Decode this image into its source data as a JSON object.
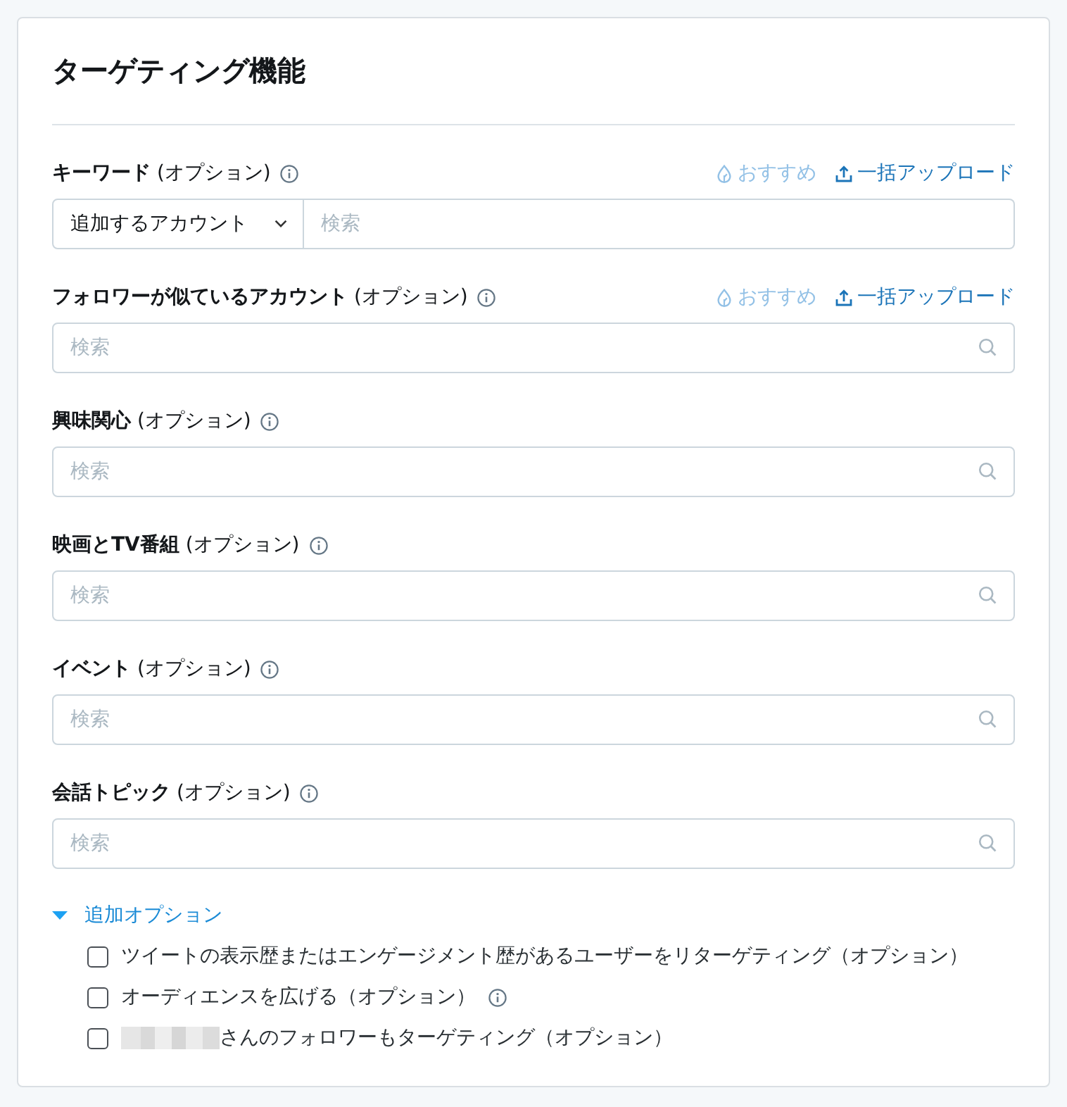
{
  "title": "ターゲティング機能",
  "fields": [
    {
      "kind": "dropdown_search",
      "label": "**キーワード** (オプション)",
      "dropdown": "追加するアカウント",
      "placeholder": "検索",
      "links": [
        {
          "kind": "recommend",
          "label": "おすすめ",
          "disabled": true
        },
        {
          "kind": "upload",
          "label": "一括アップロード",
          "disabled": false
        }
      ]
    },
    {
      "kind": "search",
      "label": "**フォロワーが似ているアカウント** (オプション)",
      "placeholder": "検索",
      "links": [
        {
          "kind": "recommend",
          "label": "おすすめ",
          "disabled": true
        },
        {
          "kind": "upload",
          "label": "一括アップロード",
          "disabled": false
        }
      ]
    },
    {
      "kind": "search",
      "label": "**興味関心** (オプション)",
      "placeholder": "検索"
    },
    {
      "kind": "search",
      "label": "**映画とTV番組** (オプション)",
      "placeholder": "検索"
    },
    {
      "kind": "search",
      "label": "**イベント** (オプション)",
      "placeholder": "検索"
    },
    {
      "kind": "search",
      "label": "**会話トピック** (オプション)",
      "placeholder": "検索"
    }
  ],
  "more_options": {
    "label": "追加オプション",
    "expanded": true,
    "options": [
      {
        "label": "ツイートの表示歴またはエンゲージメント歴があるユーザーをリターゲティング（オプション）",
        "checked": false,
        "info": false,
        "redacted_name": false
      },
      {
        "label": "オーディエンスを広げる（オプション）",
        "checked": false,
        "info": true,
        "redacted_name": false
      },
      {
        "label": "さんのフォロワーもターゲティング（オプション）",
        "checked": false,
        "info": false,
        "redacted_name": true
      }
    ]
  }
}
